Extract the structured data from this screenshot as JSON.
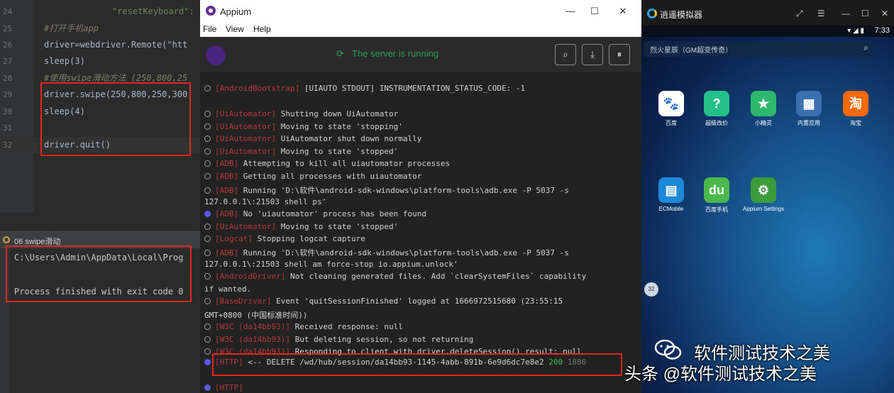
{
  "ide": {
    "lines": [
      {
        "num": "24",
        "text": "\"resetKeyboard\":",
        "kind": "string",
        "indent": "            "
      },
      {
        "num": "25",
        "text": "#打开手机app",
        "kind": "comment"
      },
      {
        "num": "26",
        "text": "driver=webdriver.Remote(\"htt",
        "kind": "code"
      },
      {
        "num": "27",
        "text": "sleep(3)",
        "kind": "code"
      },
      {
        "num": "28",
        "text": "#使用swipe滑动方法 (250,800,25",
        "kind": "comment"
      },
      {
        "num": "29",
        "text": "driver.swipe(250,800,250,300",
        "kind": "code"
      },
      {
        "num": "30",
        "text": "sleep(4)",
        "kind": "code"
      },
      {
        "num": "31",
        "text": "",
        "kind": "code"
      },
      {
        "num": "32",
        "text": "driver.quit()",
        "kind": "code"
      }
    ],
    "run_tab": "06 swipe滑动",
    "console": {
      "path": "C:\\Users\\Admin\\AppData\\Local\\Prog",
      "finished": "Process finished with exit code 0"
    }
  },
  "appium": {
    "title": "Appium",
    "menu": [
      "File",
      "View",
      "Help"
    ],
    "status": "The server is running",
    "tools": {
      "search": "search-icon",
      "download": "download-icon",
      "pause": "pause-icon"
    },
    "log": [
      {
        "tag": "[AndroidBootstrap]",
        "msg": " [UIAUTO STDOUT] INSTRUMENTATION_STATUS_CODE: -1",
        "dot": "normal"
      },
      {
        "tag": "[UiAutomator]",
        "msg": " Shutting down UiAutomator",
        "dot": "normal"
      },
      {
        "tag": "[UiAutomator]",
        "msg": " Moving to state 'stopping'",
        "dot": "normal"
      },
      {
        "tag": "[UiAutomator]",
        "msg": " UiAutomator shut down normally",
        "dot": "normal"
      },
      {
        "tag": "[UiAutomator]",
        "msg": " Moving to state 'stopped'",
        "dot": "normal"
      },
      {
        "tag": "[ADB]",
        "msg": " Attempting to kill all uiautomator processes",
        "dot": "normal"
      },
      {
        "tag": "[ADB]",
        "msg": " Getting all processes with uiautomator",
        "dot": "normal"
      },
      {
        "tag": "[ADB]",
        "msg": " Running 'D:\\软件\\android-sdk-windows\\platform-tools\\adb.exe -P 5037 -s",
        "dot": "normal"
      },
      {
        "tag": "",
        "msg": "127.0.0.1\\:21503 shell ps'",
        "dot": "none"
      },
      {
        "tag": "[ADB]",
        "msg": " No 'uiautomator' process has been found",
        "dot": "info"
      },
      {
        "tag": "[UiAutomator]",
        "msg": " Moving to state 'stopped'",
        "dot": "normal"
      },
      {
        "tag": "[Logcat]",
        "msg": " Stopping logcat capture",
        "dot": "normal"
      },
      {
        "tag": "[ADB]",
        "msg": " Running 'D:\\软件\\android-sdk-windows\\platform-tools\\adb.exe -P 5037 -s",
        "dot": "normal"
      },
      {
        "tag": "",
        "msg": "127.0.0.1\\:21503 shell am force-stop io.appium.unlock'",
        "dot": "none"
      },
      {
        "tag": "[AndroidDriver]",
        "msg": " Not cleaning generated files. Add `clearSystemFiles` capability",
        "dot": "normal"
      },
      {
        "tag": "",
        "msg": "if wanted.",
        "dot": "none"
      },
      {
        "tag": "[BaseDriver]",
        "msg": " Event 'quitSessionFinished' logged at 1666972515680 (23:55:15",
        "dot": "normal"
      },
      {
        "tag": "",
        "msg": "GMT+0800 (中国标准时间))",
        "dot": "none"
      },
      {
        "tag": "[W3C (da14bb93)]",
        "msg": " Received response: null",
        "dot": "normal"
      },
      {
        "tag": "[W3C (da14bb93)]",
        "msg": " But deleting session, so not returning",
        "dot": "normal"
      },
      {
        "tag": "[W3C (da14bb93)]",
        "msg": " Responding to client with driver.deleteSession() result: null",
        "dot": "normal"
      }
    ],
    "http_line": {
      "tag": "[HTTP]",
      "msg": " <-- DELETE /wd/hub/session/da14bb93-1145-4abb-891b-6e9d6dc7e8e2 ",
      "code": "200",
      "time": " 1880"
    },
    "last_tag": "[HTTP]"
  },
  "emulator": {
    "title": "逍遥模拟器",
    "time": "7:33",
    "search_placeholder": "烈火星辰（GM超变传奇）",
    "apps": [
      {
        "label": "百度",
        "glyph": "🐾",
        "color": "#ffffff"
      },
      {
        "label": "超级改价",
        "glyph": "?",
        "color": "#23c08a"
      },
      {
        "label": "小精灵",
        "glyph": "★",
        "color": "#2eb86e"
      },
      {
        "label": "内置应用",
        "glyph": "▦",
        "color": "#3c6fb0"
      },
      {
        "label": "淘宝",
        "glyph": "淘",
        "color": "#ff6a00"
      },
      {
        "label": "ECMobile",
        "glyph": "▤",
        "color": "#1e88d8"
      },
      {
        "label": "百度手机",
        "glyph": "du",
        "color": "#4bb84b"
      },
      {
        "label": "Appium Settings",
        "glyph": "⚙",
        "color": "#3c9c3c"
      }
    ],
    "badge": "32"
  },
  "watermark": {
    "top": "软件测试技术之美",
    "bottom": "头条 @软件测试技术之美"
  }
}
